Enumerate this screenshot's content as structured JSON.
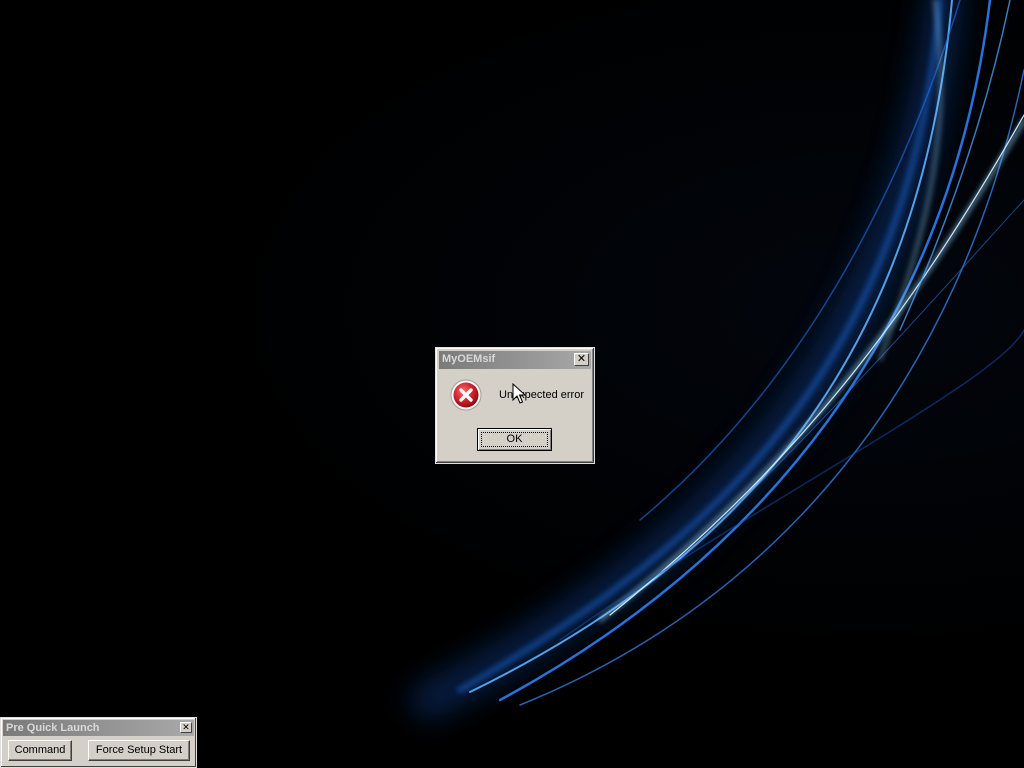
{
  "dialog": {
    "title": "MyOEMsif",
    "close_glyph": "✕",
    "message": "Unexpected error",
    "icon": "error-icon",
    "ok_label": "OK"
  },
  "quick_launch": {
    "title": "Pre Quick Launch",
    "close_glyph": "✕",
    "buttons": {
      "command": "Command",
      "force_setup_start": "Force Setup Start"
    }
  },
  "colors": {
    "wallpaper_background": "#000000",
    "wallpaper_accent": "#2a8cff",
    "dialog_face": "#d4d0c8",
    "titlebar_inactive": "#8a8a8a",
    "error_red": "#d0202a"
  }
}
